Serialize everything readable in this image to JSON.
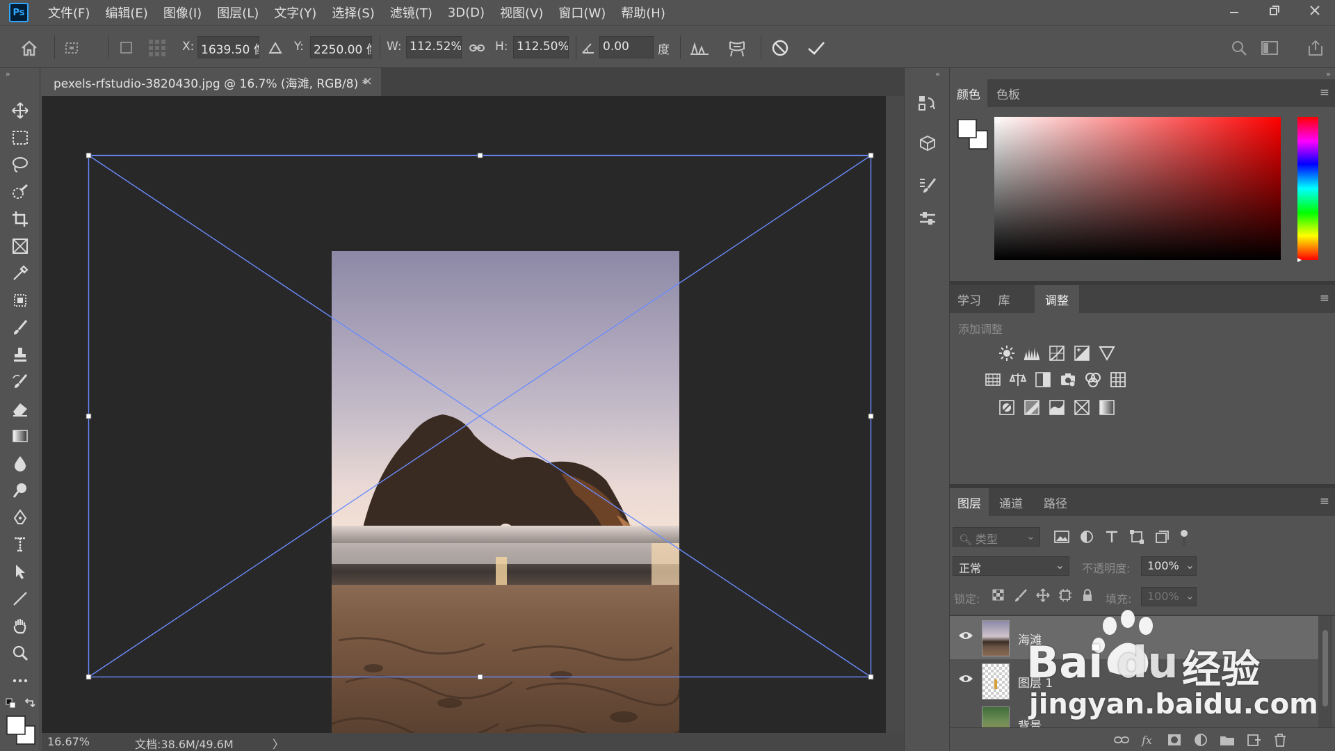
{
  "app": {
    "logo": "Ps",
    "menu": [
      "文件(F)",
      "编辑(E)",
      "图像(I)",
      "图层(L)",
      "文字(Y)",
      "选择(S)",
      "滤镜(T)",
      "3D(D)",
      "视图(V)",
      "窗口(W)",
      "帮助(H)"
    ]
  },
  "options": {
    "x_label": "X:",
    "x_value": "1639.50 像",
    "y_label": "Y:",
    "y_value": "2250.00 像",
    "w_label": "W:",
    "w_value": "112.52%",
    "h_label": "H:",
    "h_value": "112.50%",
    "angle_value": "0.00",
    "angle_unit": "度"
  },
  "document": {
    "tab_title": "pexels-rfstudio-3820430.jpg @ 16.7% (海滩, RGB/8) *",
    "close": "×",
    "zoom": "16.67%",
    "doc_size": "文档:38.6M/49.6M",
    "status_arrow": "〉"
  },
  "color_panel": {
    "tabs": [
      "颜色",
      "色板"
    ],
    "accent_hue": "#ff0000"
  },
  "adjust_panel": {
    "tabs": [
      "学习",
      "库",
      "调整"
    ],
    "add_label": "添加调整"
  },
  "layers_panel": {
    "tabs": [
      "图层",
      "通道",
      "路径"
    ],
    "filter_placeholder": "类型",
    "blend_mode": "正常",
    "opacity_label": "不透明度:",
    "opacity_value": "100%",
    "lock_label": "锁定:",
    "fill_label": "填充:",
    "fill_value": "100%",
    "layers": [
      {
        "name": "海滩",
        "selected": true
      },
      {
        "name": "图层 1",
        "selected": false
      },
      {
        "name": "背景",
        "selected": false
      }
    ]
  },
  "watermark": {
    "brand": "Bai",
    "brand2": "du",
    "cn": "经验",
    "url": "jingyan.baidu.com"
  }
}
